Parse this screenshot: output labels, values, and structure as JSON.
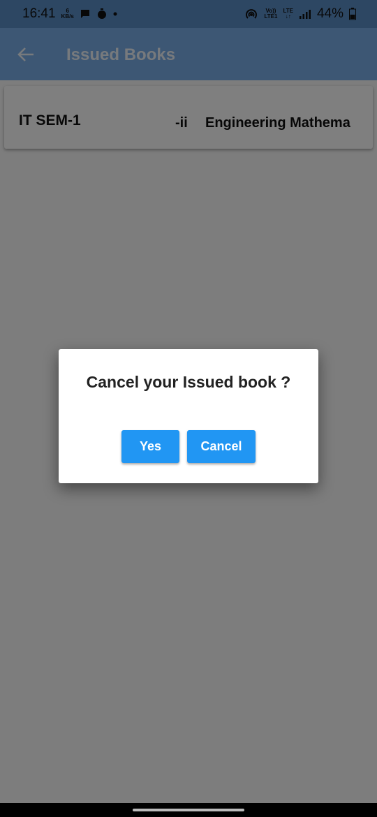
{
  "status_bar": {
    "time": "16:41",
    "net_speed_value": "6",
    "net_speed_unit": "KB/s",
    "volte_label": "Vo))",
    "lte_label": "LTE",
    "lte1_label": "LTE1",
    "battery": "44%"
  },
  "app_bar": {
    "title": "Issued Books"
  },
  "issued_books": [
    {
      "course": "IT SEM-1",
      "part": "-ii",
      "book": "Engineering Mathema"
    }
  ],
  "dialog": {
    "message": "Cancel your Issued book ?",
    "yes_label": "Yes",
    "cancel_label": "Cancel"
  },
  "colors": {
    "status_bar": "#5b8ec7",
    "app_bar": "#7aaee9",
    "primary_button": "#2196f3"
  }
}
